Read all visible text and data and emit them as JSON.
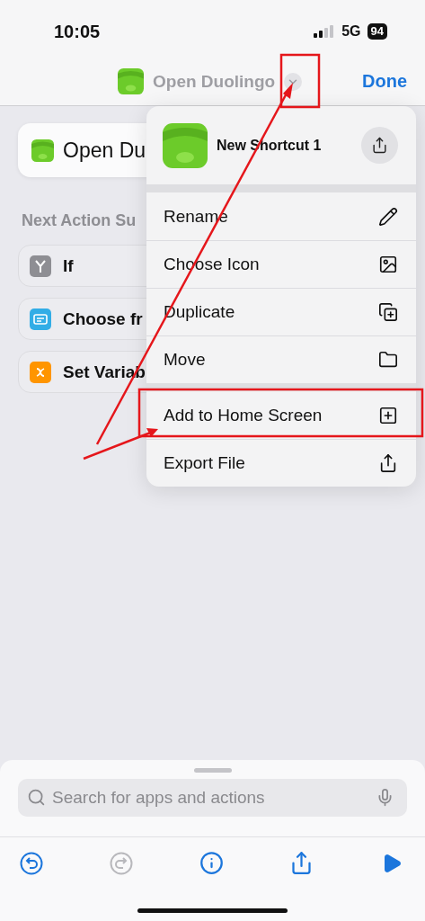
{
  "status_bar": {
    "time": "10:05",
    "network": "5G",
    "battery": "94"
  },
  "nav": {
    "title": "Open Duolingo",
    "done": "Done"
  },
  "action": {
    "label": "Open Du"
  },
  "suggestions": {
    "heading": "Next Action Su",
    "items": [
      {
        "label": "If",
        "kind": "condition",
        "color": "#8e8e93"
      },
      {
        "label": "Choose fr",
        "kind": "menu",
        "color": "#32ade6"
      },
      {
        "label": "Set Variab",
        "kind": "variable",
        "color": "#ff9500"
      }
    ]
  },
  "menu": {
    "title": "New Shortcut 1",
    "groups": [
      [
        {
          "label": "Rename",
          "kind": "rename"
        },
        {
          "label": "Choose Icon",
          "kind": "icon"
        },
        {
          "label": "Duplicate",
          "kind": "duplicate"
        },
        {
          "label": "Move",
          "kind": "move"
        }
      ],
      [
        {
          "label": "Add to Home Screen",
          "kind": "home"
        },
        {
          "label": "Export File",
          "kind": "export"
        }
      ]
    ]
  },
  "search": {
    "placeholder": "Search for apps and actions"
  },
  "toolbar": [
    {
      "kind": "undo",
      "disabled": false
    },
    {
      "kind": "redo",
      "disabled": true
    },
    {
      "kind": "info",
      "disabled": false
    },
    {
      "kind": "share",
      "disabled": false
    },
    {
      "kind": "run",
      "disabled": false
    }
  ]
}
